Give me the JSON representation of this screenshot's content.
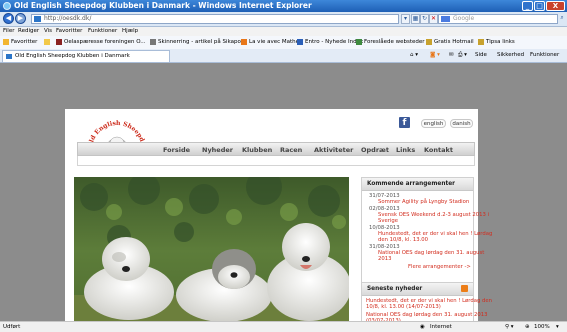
{
  "window": {
    "title": "Old English Sheepdog Klubben i Danmark - Windows Internet Explorer",
    "minimize": "_",
    "maximize": "□",
    "close": "X"
  },
  "address": {
    "url": "http://oesdk.dk/",
    "search_placeholder": "Google"
  },
  "menu": [
    "Filer",
    "Rediger",
    "Vis",
    "Favoritter",
    "Funktioner",
    "Hjælp"
  ],
  "favorites": {
    "label": "Favoritter",
    "items": [
      "Oelaspæresse foreningen O...",
      "Skinnerring - artikel på Sikaport",
      "La vie avec Matheo",
      "Entro - Nyhede Index",
      "Foreslåede websteder",
      "Gratis Hotmail",
      "Tipsa links"
    ]
  },
  "tab": {
    "label": "Old English Sheepdog Klubben i Danmark"
  },
  "tab_tools": {
    "side": "Side",
    "sikkerhed": "Sikkerhed",
    "funktioner": "Funktioner"
  },
  "site": {
    "logo_text": "Old English Sheepdog Klubben i Danmark",
    "lang_english": "english",
    "lang_danish": "danish",
    "facebook_icon": "f",
    "nav": [
      "Forside",
      "Nyheder",
      "Klubben",
      "Racen",
      "Aktiviteter",
      "Opdræt",
      "Links",
      "Kontakt"
    ]
  },
  "events": {
    "heading": "Kommende arrangementer",
    "items": [
      {
        "date": "31/07-2013",
        "lines": [
          "Sommer Agility på Lyngby Stadion"
        ]
      },
      {
        "date": "02/08-2013",
        "lines": [
          "Svensk OES Weekend d.2-3 august 2013 i",
          "Sverige"
        ]
      },
      {
        "date": "10/08-2013",
        "lines": [
          "Hundestedt, det er der vi skal hen ! Lørdag",
          "den 10/8, kl. 13.00"
        ]
      },
      {
        "date": "31/08-2013",
        "lines": [
          "National OES dag lørdag den 31. august",
          "2013"
        ]
      }
    ],
    "more": "Flere arrangementer ->"
  },
  "news": {
    "heading": "Seneste nyheder",
    "rss_icon": "rss-icon",
    "items": [
      {
        "lines": [
          "Hundestedt, det er der vi skal hen ! Lørdag den",
          "10/8, kl. 13.00 (14/07-2013)"
        ]
      },
      {
        "lines": [
          "National OES dag lørdag den 31. august 2013",
          "(03/07-2013)"
        ]
      }
    ]
  },
  "status": {
    "left": "Udført",
    "zone": "Internet",
    "zoom": "100%"
  },
  "colors": {
    "titlebar": "#1e5fb5",
    "accent_red": "#d22b1c",
    "facebook": "#3b5998",
    "page_bg": "#8c8c8c"
  }
}
